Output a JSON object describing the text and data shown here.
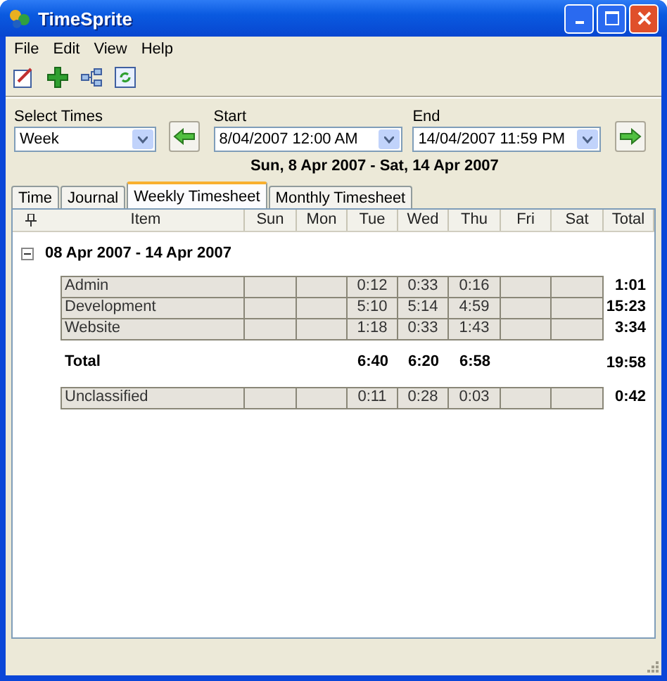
{
  "window": {
    "title": "TimeSprite"
  },
  "menu": [
    "File",
    "Edit",
    "View",
    "Help"
  ],
  "filter": {
    "select_times": {
      "label": "Select Times",
      "value": "Week"
    },
    "start": {
      "label": "Start",
      "value": "8/04/2007 12:00 AM"
    },
    "end": {
      "label": "End",
      "value": "14/04/2007 11:59 PM"
    },
    "range": "Sun, 8 Apr 2007 - Sat, 14 Apr 2007"
  },
  "tabs": [
    {
      "label": "Time",
      "selected": false
    },
    {
      "label": "Journal",
      "selected": false
    },
    {
      "label": "Weekly Timesheet",
      "selected": true
    },
    {
      "label": "Monthly Timesheet",
      "selected": false
    }
  ],
  "table": {
    "columns": [
      "Item",
      "Sun",
      "Mon",
      "Tue",
      "Wed",
      "Thu",
      "Fri",
      "Sat",
      "Total"
    ],
    "group": {
      "title": "08 Apr 2007 - 14 Apr 2007",
      "expanded": true
    },
    "rows": [
      {
        "item": "Admin",
        "days": {
          "tue": "0:12",
          "wed": "0:33",
          "thu": "0:16"
        },
        "total": "1:01"
      },
      {
        "item": "Development",
        "days": {
          "tue": "5:10",
          "wed": "5:14",
          "thu": "4:59"
        },
        "total": "15:23"
      },
      {
        "item": "Website",
        "days": {
          "tue": "1:18",
          "wed": "0:33",
          "thu": "1:43"
        },
        "total": "3:34"
      }
    ],
    "total_row": {
      "label": "Total",
      "days": {
        "tue": "6:40",
        "wed": "6:20",
        "thu": "6:58"
      },
      "total": "19:58"
    },
    "unclassified": {
      "item": "Unclassified",
      "days": {
        "tue": "0:11",
        "wed": "0:28",
        "thu": "0:03"
      },
      "total": "0:42"
    }
  }
}
